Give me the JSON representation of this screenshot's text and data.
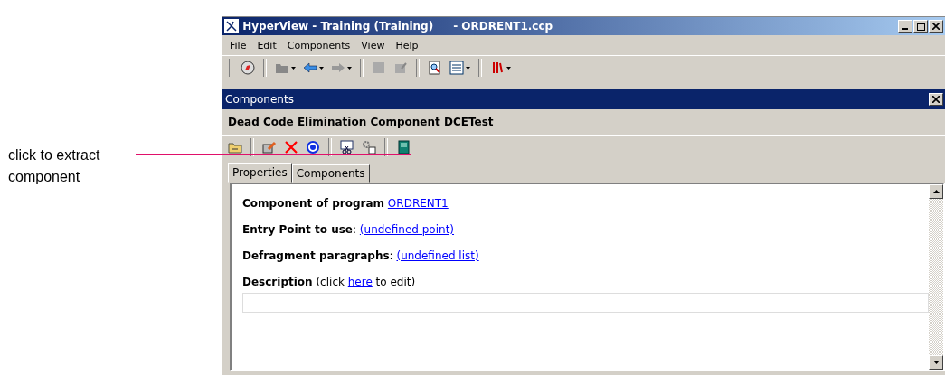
{
  "annotation": {
    "text": "click to extract component"
  },
  "window": {
    "title": "HyperView - Training (Training)",
    "document": "- ORDRENT1.ccp"
  },
  "menu": [
    "File",
    "Edit",
    "Components",
    "View",
    "Help"
  ],
  "panel": {
    "title": "Components",
    "heading": "Dead Code Elimination Component DCETest"
  },
  "tabs": [
    {
      "label": "Properties",
      "selected": true
    },
    {
      "label": "Components",
      "selected": false
    }
  ],
  "properties": [
    {
      "before": "**Component of program** ",
      "link": "ORDRENT1"
    },
    {
      "before": "**Entry Point to use**: ",
      "link": "(undefined point)"
    },
    {
      "before": "**Defragment paragraphs**: ",
      "link": "(undefined list)"
    },
    {
      "before": "**Description** (click ",
      "link": "here",
      "after": " to edit)"
    }
  ]
}
